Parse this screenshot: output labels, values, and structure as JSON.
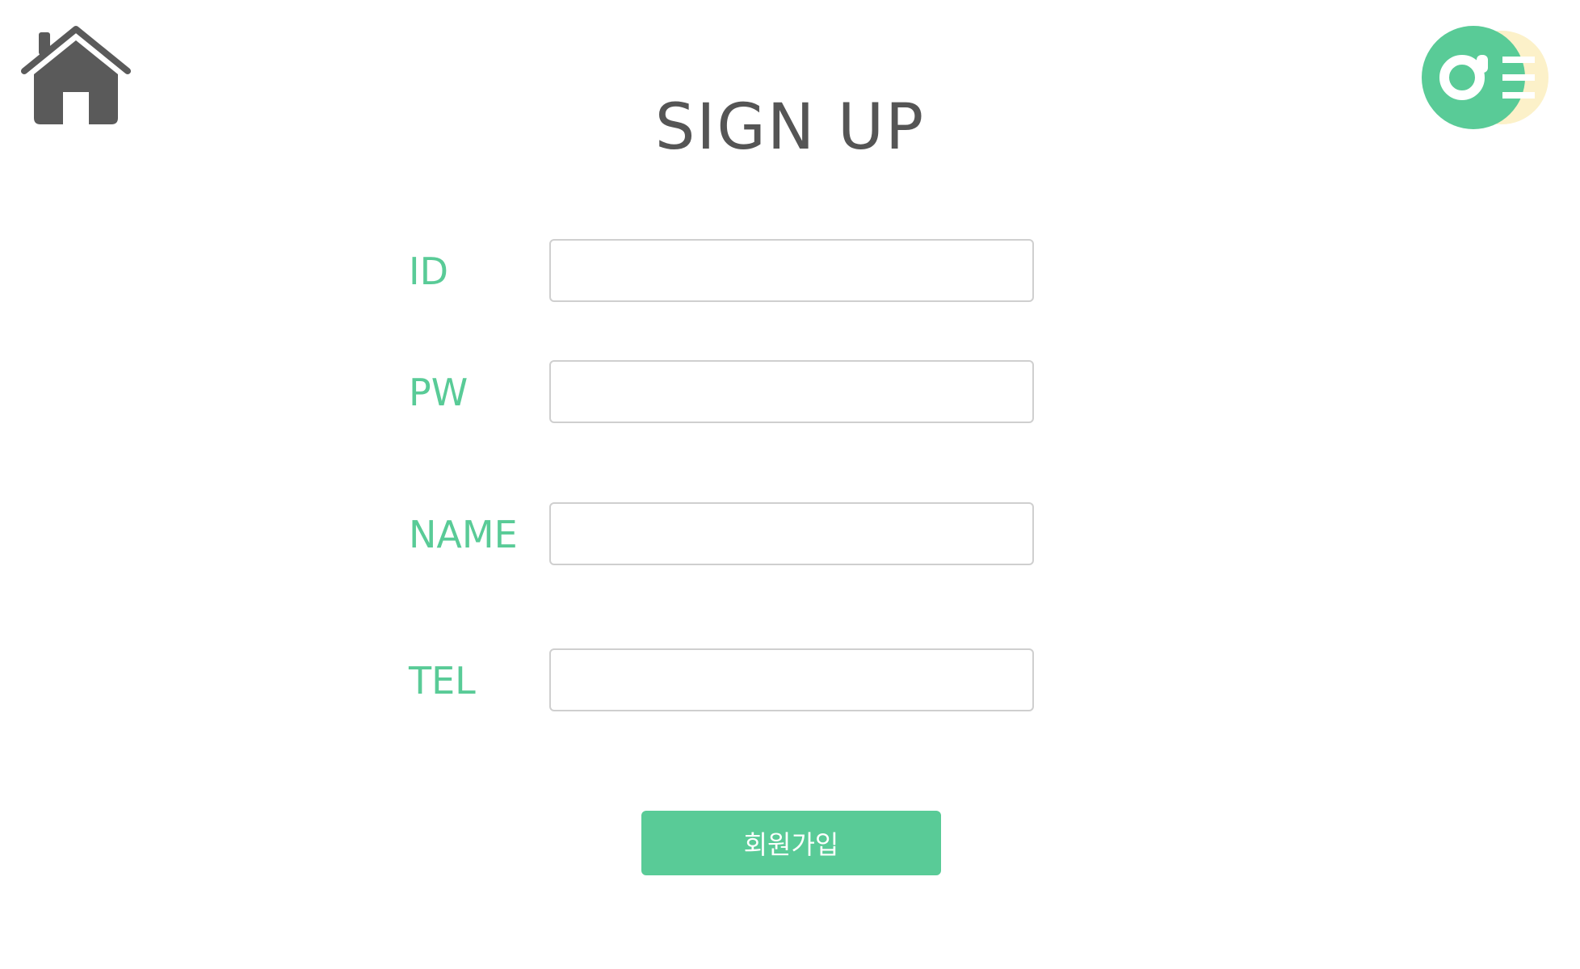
{
  "header": {
    "home_icon": "home-icon",
    "logo_icon": "search-menu-logo",
    "title": "SIGN UP"
  },
  "form": {
    "fields": [
      {
        "label": "ID",
        "value": "",
        "type": "text"
      },
      {
        "label": "PW",
        "value": "",
        "type": "password"
      },
      {
        "label": "NAME",
        "value": "",
        "type": "text"
      },
      {
        "label": "TEL",
        "value": "",
        "type": "tel"
      }
    ],
    "submit_label": "회원가입"
  },
  "colors": {
    "accent": "#59cb97",
    "logo_cream": "#fcf1c9",
    "icon_gray": "#5a5a5a",
    "title_gray": "#555555",
    "input_border": "#cfcfcf"
  }
}
